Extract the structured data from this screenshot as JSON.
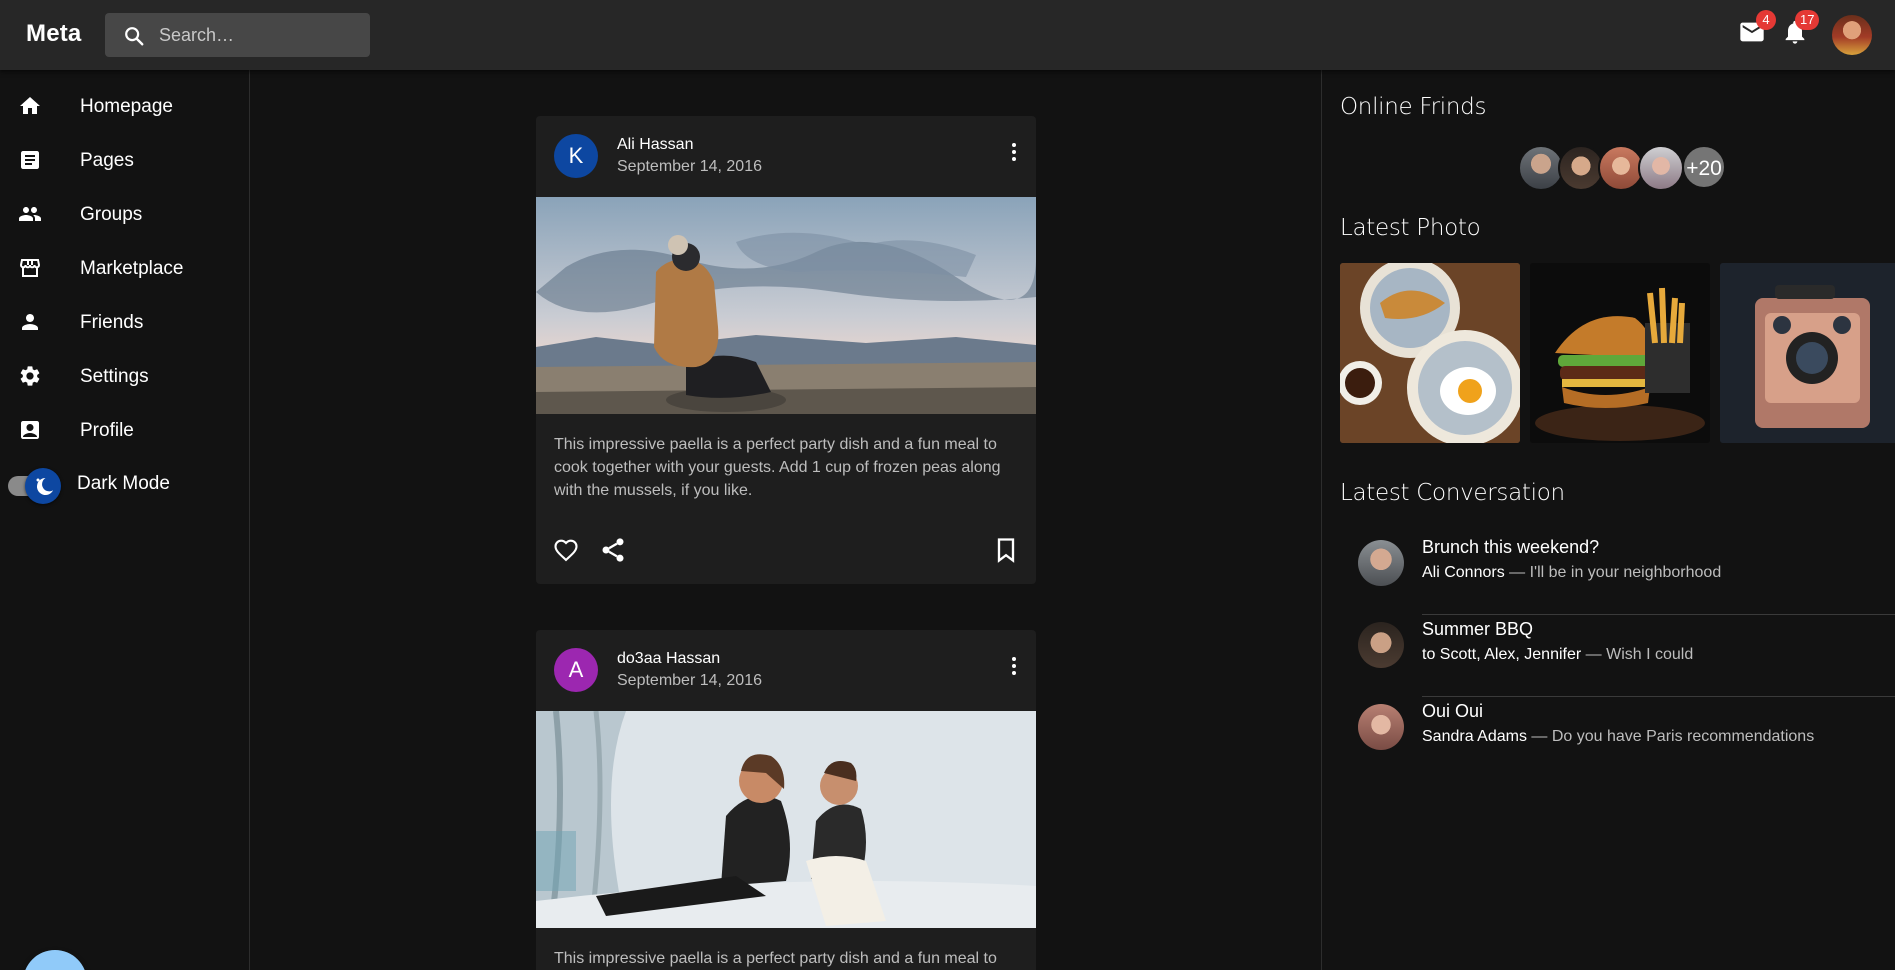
{
  "app": {
    "title": "Meta"
  },
  "search": {
    "placeholder": "Search…"
  },
  "header": {
    "mail_count": "4",
    "notification_count": "17"
  },
  "sidebar": {
    "items": [
      {
        "label": "Homepage",
        "icon": "home-icon"
      },
      {
        "label": "Pages",
        "icon": "article-icon"
      },
      {
        "label": "Groups",
        "icon": "group-icon"
      },
      {
        "label": "Marketplace",
        "icon": "storefront-icon"
      },
      {
        "label": "Friends",
        "icon": "person-icon"
      },
      {
        "label": "Settings",
        "icon": "gear-icon"
      },
      {
        "label": "Profile",
        "icon": "contact-card-icon"
      }
    ],
    "dark_mode_label": "Dark Mode",
    "dark_mode_on": true
  },
  "feed": {
    "posts": [
      {
        "avatar_letter": "K",
        "avatar_color": "#0d47a1",
        "author": "Ali Hassan",
        "date": "September 14, 2016",
        "text": "This impressive paella is a perfect party dish and a fun meal to cook together with your guests. Add 1 cup of frozen peas along with the mussels, if you like."
      },
      {
        "avatar_letter": "A",
        "avatar_color": "#9c27b0",
        "author": "do3aa Hassan",
        "date": "September 14, 2016",
        "text": "This impressive paella is a perfect party dish and a fun meal to cook together with your guests. Add 1 cup of frozen peas along with the mussels, if you like."
      }
    ]
  },
  "right_panel": {
    "online_title": "Online Frinds",
    "online_more": "+20",
    "photos_title": "Latest Photo",
    "conversation_title": "Latest Conversation",
    "conversations": [
      {
        "title": "Brunch this weekend?",
        "who": "Ali Connors",
        "snippet": " — I'll be in your neighborhood"
      },
      {
        "title": "Summer BBQ",
        "who": "to Scott, Alex, Jennifer",
        "snippet": " — Wish I could"
      },
      {
        "title": "Oui Oui",
        "who": "Sandra Adams",
        "snippet": " — Do you have Paris recommendations"
      }
    ]
  },
  "colors": {
    "background": "#121212",
    "surface": "#1e1e1e",
    "appbar": "#272727",
    "fab": "#90caf9",
    "badge": "#e53935"
  }
}
